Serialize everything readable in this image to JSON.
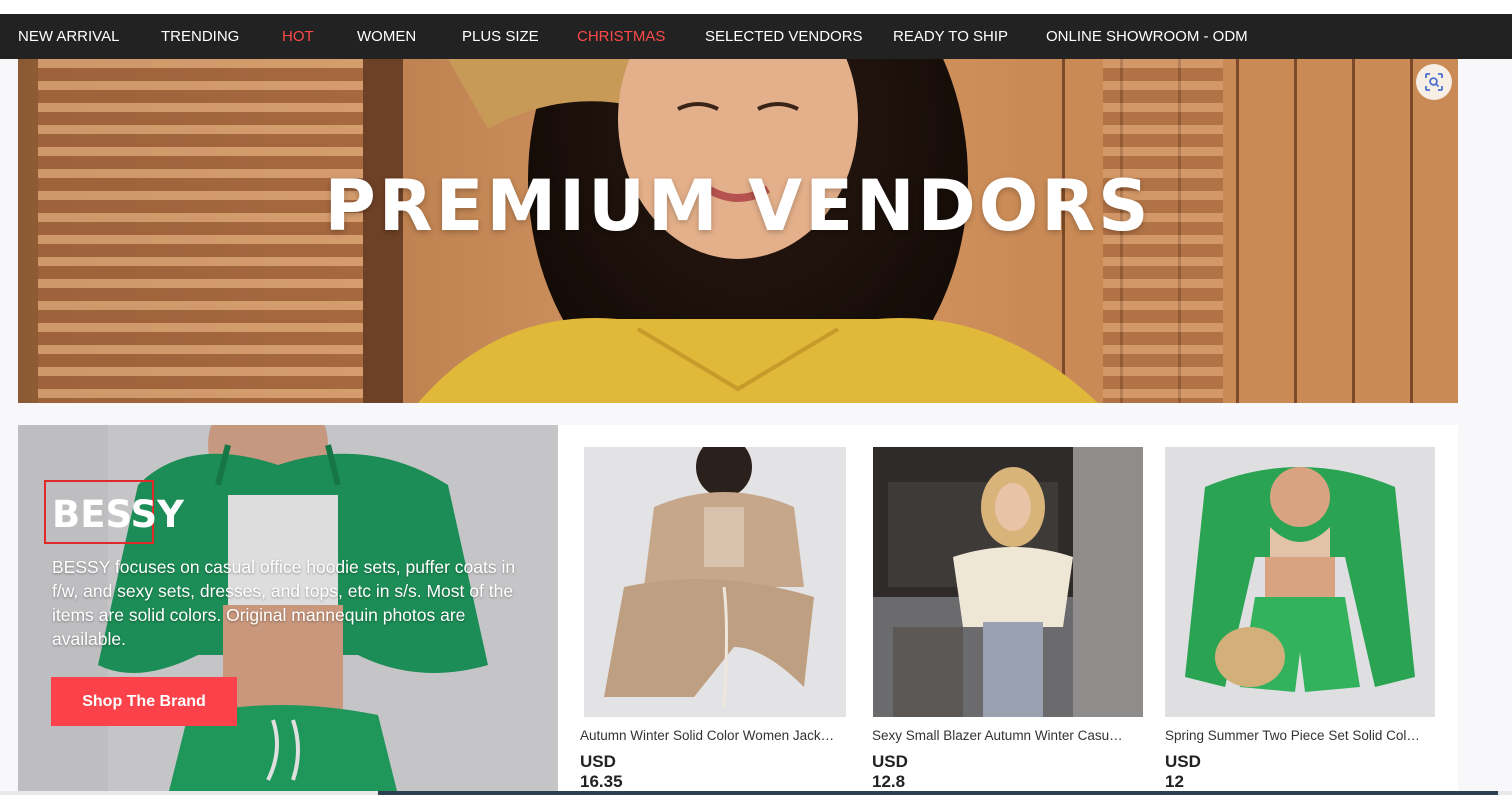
{
  "nav": {
    "items": [
      {
        "label": "NEW ARRIVAL",
        "color": "#ffffff"
      },
      {
        "label": "TRENDING",
        "color": "#ffffff"
      },
      {
        "label": "HOT",
        "color": "#ff4a4a"
      },
      {
        "label": "WOMEN",
        "color": "#ffffff"
      },
      {
        "label": "PLUS SIZE",
        "color": "#ffffff"
      },
      {
        "label": "CHRISTMAS",
        "color": "#ff4a4a"
      },
      {
        "label": "SELECTED VENDORS",
        "color": "#ffffff"
      },
      {
        "label": "READY TO SHIP",
        "color": "#ffffff"
      },
      {
        "label": "ONLINE SHOWROOM - ODM",
        "color": "#ffffff"
      }
    ]
  },
  "hero": {
    "title": "PREMIUM VENDORS",
    "lens_icon": "visual-search-icon"
  },
  "brand": {
    "name": "BESSY",
    "description": "BESSY focuses on casual office hoodie sets, puffer coats in f/w, and sexy sets, dresses, and tops, etc in s/s. Most of the items are solid colors. Original mannequin photos are available.",
    "cta": "Shop The Brand",
    "cta_color": "#fb4149"
  },
  "products": [
    {
      "title": "Autumn Winter Solid Color Women Jacket Set",
      "price": "USD 16.35"
    },
    {
      "title": "Sexy Small Blazer Autumn Winter Casual Suit",
      "price": "USD 12.8"
    },
    {
      "title": "Spring Summer Two Piece Set Solid Color Shorts",
      "price": "USD 12"
    }
  ]
}
